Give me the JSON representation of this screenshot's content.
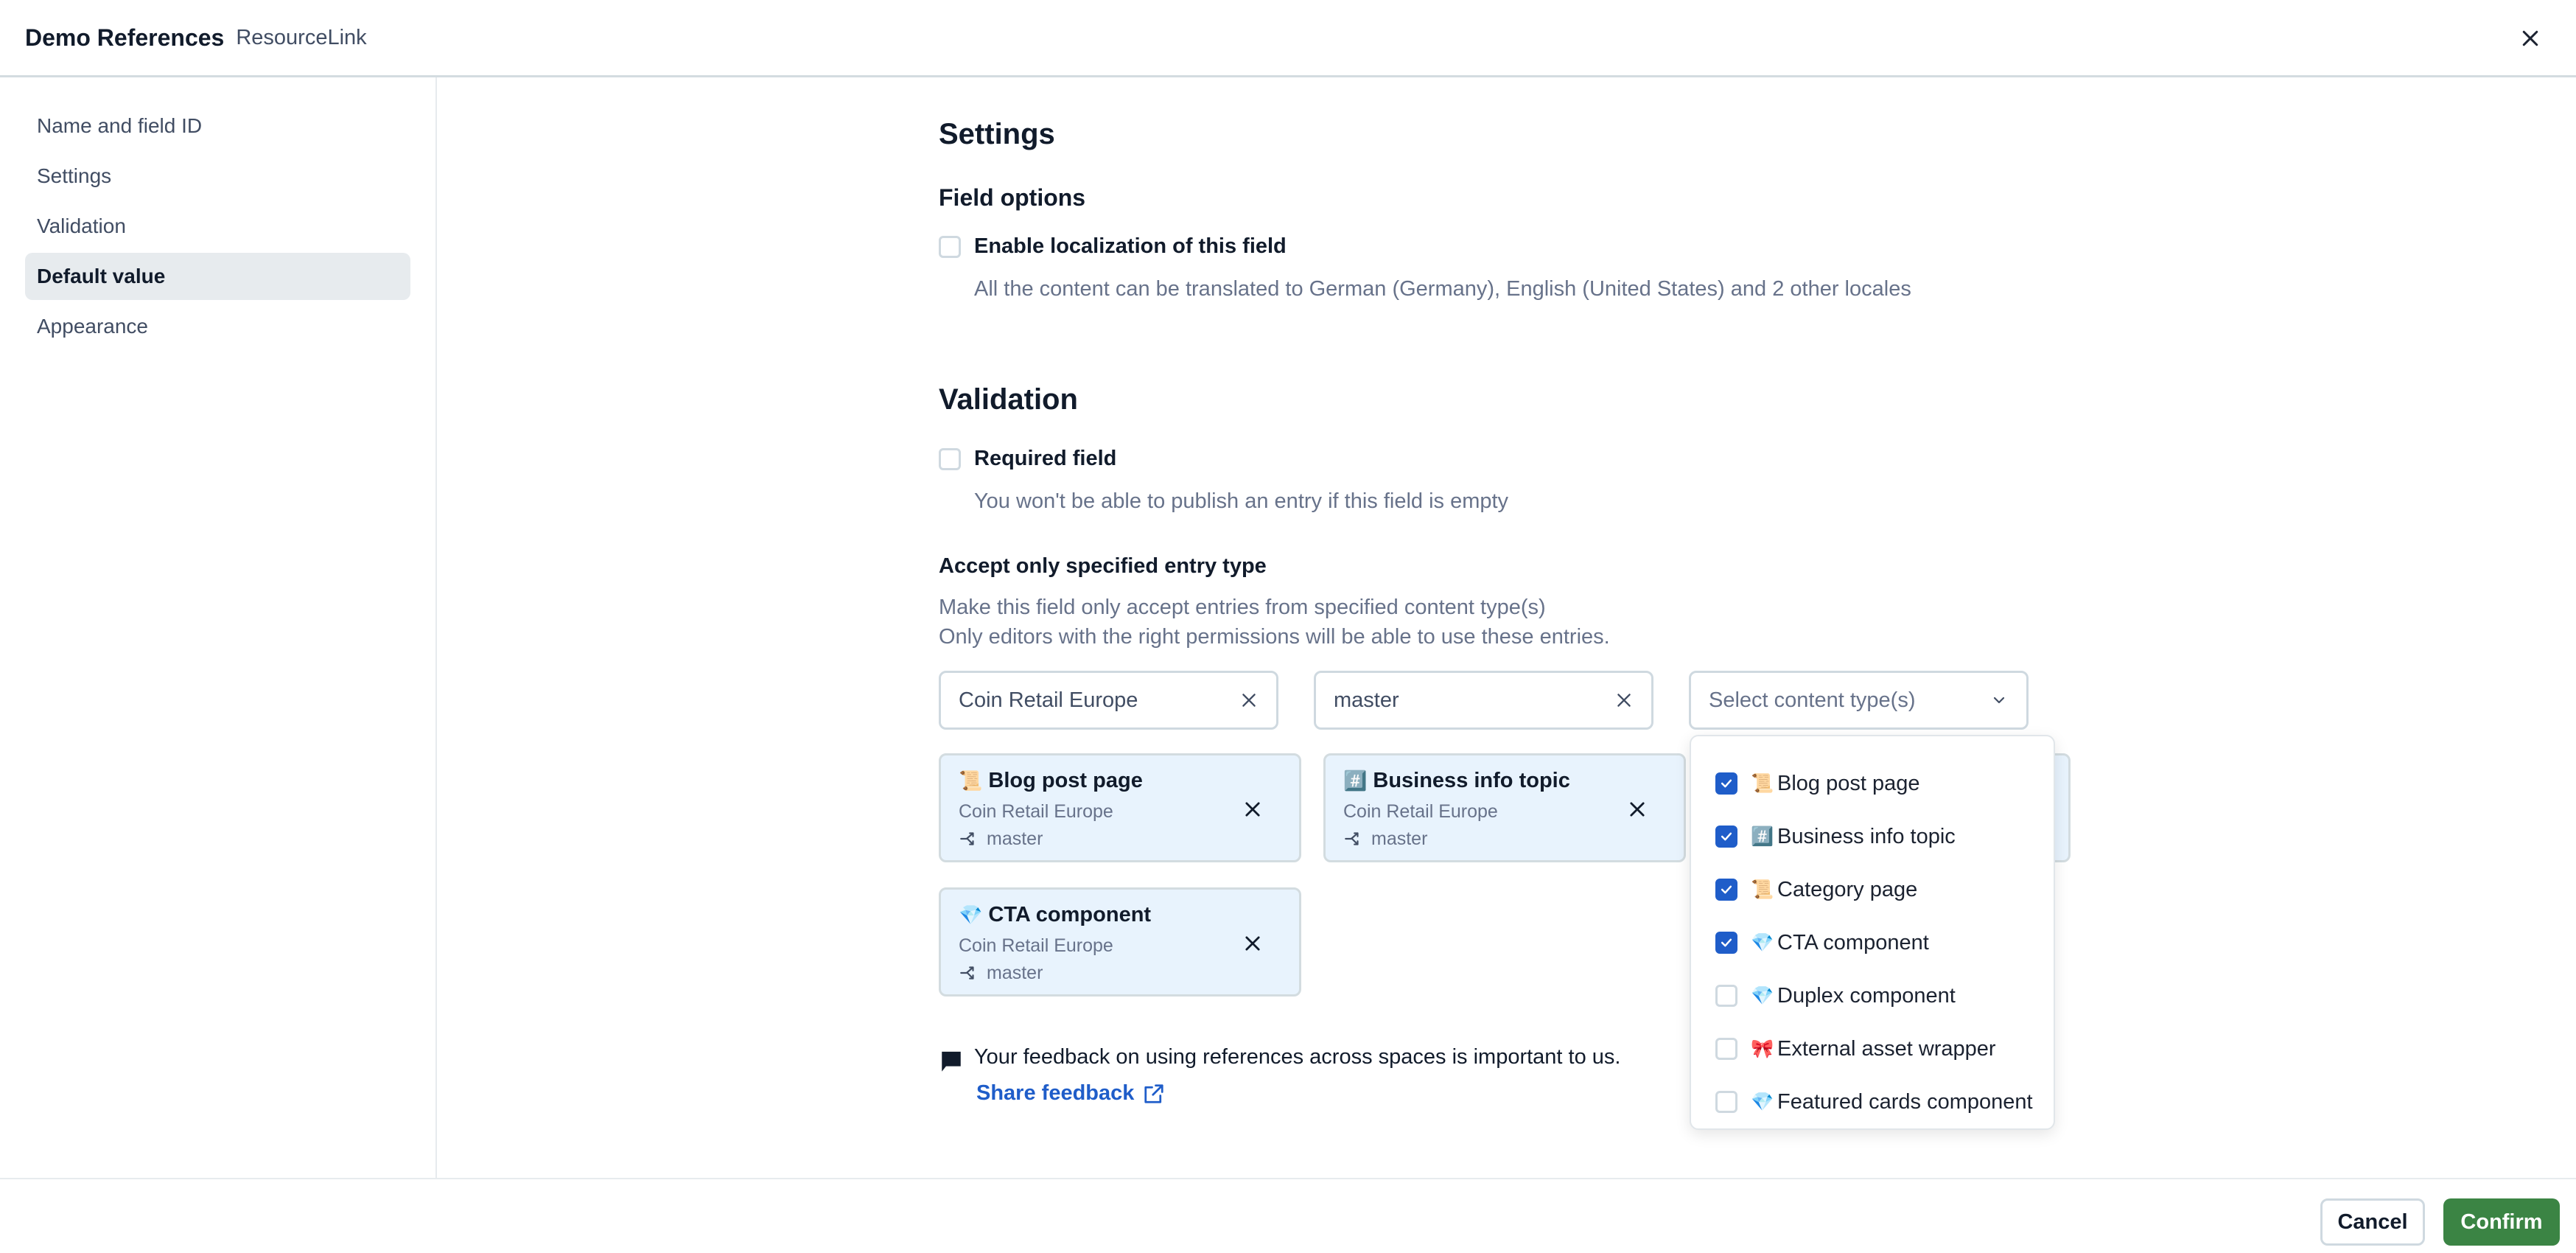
{
  "header": {
    "title": "Demo References",
    "subtitle": "ResourceLink",
    "close_icon": "close-icon"
  },
  "sidebar": {
    "items": [
      {
        "label": "Name and field ID",
        "active": false
      },
      {
        "label": "Settings",
        "active": false
      },
      {
        "label": "Validation",
        "active": false
      },
      {
        "label": "Default value",
        "active": true
      },
      {
        "label": "Appearance",
        "active": false
      }
    ]
  },
  "settings": {
    "title": "Settings",
    "field_options_title": "Field options",
    "localization_label": "Enable localization of this field",
    "localization_checked": false,
    "localization_help": "All the content can be translated to German (Germany), English (United States) and 2 other locales"
  },
  "validation": {
    "title": "Validation",
    "required_label": "Required field",
    "required_checked": false,
    "required_help": "You won't be able to publish an entry if this field is empty",
    "accept_title": "Accept only specified entry type",
    "accept_help_1": "Make this field only accept entries from specified content type(s)",
    "accept_help_2": "Only editors with the right permissions will be able to use these entries.",
    "space_field": {
      "value": "Coin Retail Europe"
    },
    "environment_field": {
      "value": "master"
    },
    "content_type_select": {
      "placeholder": "Select content type(s)"
    },
    "selected_cards": [
      {
        "emoji": "📜",
        "title": "Blog post page",
        "space": "Coin Retail Europe",
        "branch": "master"
      },
      {
        "emoji": "#️⃣",
        "title": "Business info topic",
        "space": "Coin Retail Europe",
        "branch": "master"
      },
      {
        "emoji": "",
        "title": "",
        "space": "",
        "branch": ""
      },
      {
        "emoji": "💎",
        "title": "CTA component",
        "space": "Coin Retail Europe",
        "branch": "master"
      }
    ],
    "dropdown_options": [
      {
        "emoji": "📜",
        "label": "Blog post page",
        "checked": true
      },
      {
        "emoji": "#️⃣",
        "label": "Business info topic",
        "checked": true
      },
      {
        "emoji": "📜",
        "label": "Category page",
        "checked": true
      },
      {
        "emoji": "💎",
        "label": "CTA component",
        "checked": true
      },
      {
        "emoji": "💎",
        "label": "Duplex component",
        "checked": false
      },
      {
        "emoji": "🎀",
        "label": "External asset wrapper",
        "checked": false
      },
      {
        "emoji": "💎",
        "label": "Featured cards component",
        "checked": false
      }
    ]
  },
  "feedback": {
    "text": "Your feedback on using references across spaces is important to us.",
    "link_label": "Share feedback"
  },
  "footer": {
    "cancel_label": "Cancel",
    "confirm_label": "Confirm"
  },
  "colors": {
    "primary_blue": "#1f5dc9",
    "confirm_green": "#3b8444",
    "card_bg": "#e8f3fd",
    "text_dark": "#111b2b",
    "text_muted": "#67728a"
  }
}
